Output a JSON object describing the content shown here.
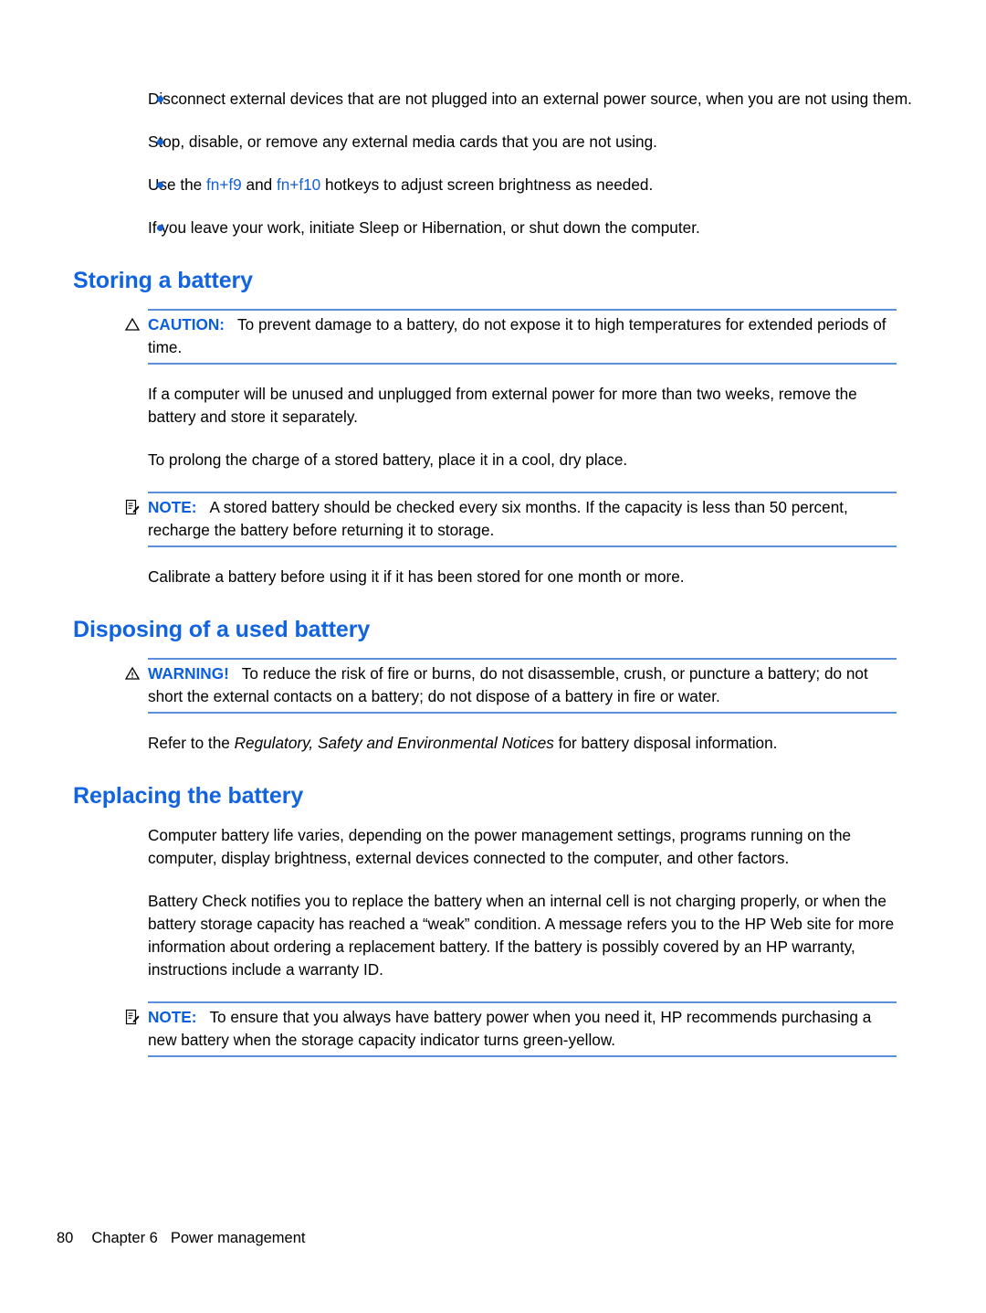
{
  "page": {
    "number": "80",
    "chapter": "Chapter 6",
    "chapter_title": "Power management"
  },
  "colors": {
    "heading_blue": "#1163e0",
    "label_blue": "#0a5fe0",
    "bullet_blue": "#1461d2",
    "rule_blue": "#5a8fdb",
    "body_black": "#000000"
  },
  "bullets": [
    {
      "text": "Disconnect external devices that are not plugged into an external power source, when you are not using them."
    },
    {
      "text": "Stop, disable, or remove any external media cards that you are not using."
    },
    {
      "text_before": "Use the ",
      "kbd1": "fn+f9",
      "text_mid": " and ",
      "kbd2": "fn+f10",
      "text_after": " hotkeys to adjust screen brightness as needed."
    },
    {
      "text": "If you leave your work, initiate Sleep or Hibernation, or shut down the computer."
    }
  ],
  "sections": [
    {
      "heading": "Storing a battery",
      "caution": {
        "icon": "caution-triangle-icon",
        "label": "CAUTION:",
        "text": "To prevent damage to a battery, do not expose it to high temperatures for extended periods of time."
      },
      "paragraphs": [
        "If a computer will be unused and unplugged from external power for more than two weeks, remove the battery and store it separately.",
        "To prolong the charge of a stored battery, place it in a cool, dry place."
      ],
      "note": {
        "icon": "note-pad-pencil-icon",
        "label": "NOTE:",
        "text": "A stored battery should be checked every six months. If the capacity is less than 50 percent, recharge the battery before returning it to storage."
      },
      "paragraphs_after": [
        "Calibrate a battery before using it if it has been stored for one month or more."
      ]
    },
    {
      "heading": "Disposing of a used battery",
      "warning": {
        "icon": "warning-triangle-icon",
        "label": "WARNING!",
        "text": "To reduce the risk of fire or burns, do not disassemble, crush, or puncture a battery; do not short the external contacts on a battery; do not dispose of a battery in fire or water."
      },
      "refer": {
        "before": "Refer to the ",
        "italic": "Regulatory, Safety and Environmental Notices",
        "after": " for battery disposal information."
      }
    },
    {
      "heading": "Replacing the battery",
      "paragraphs": [
        "Computer battery life varies, depending on the power management settings, programs running on the computer, display brightness, external devices connected to the computer, and other factors.",
        "Battery Check notifies you to replace the battery when an internal cell is not charging properly, or when the battery storage capacity has reached a “weak” condition. A message refers you to the HP Web site for more information about ordering a replacement battery. If the battery is possibly covered by an HP warranty, instructions include a warranty ID."
      ],
      "note": {
        "icon": "note-pad-pencil-icon",
        "label": "NOTE:",
        "text": "To ensure that you always have battery power when you need it, HP recommends purchasing a new battery when the storage capacity indicator turns green-yellow."
      }
    }
  ]
}
